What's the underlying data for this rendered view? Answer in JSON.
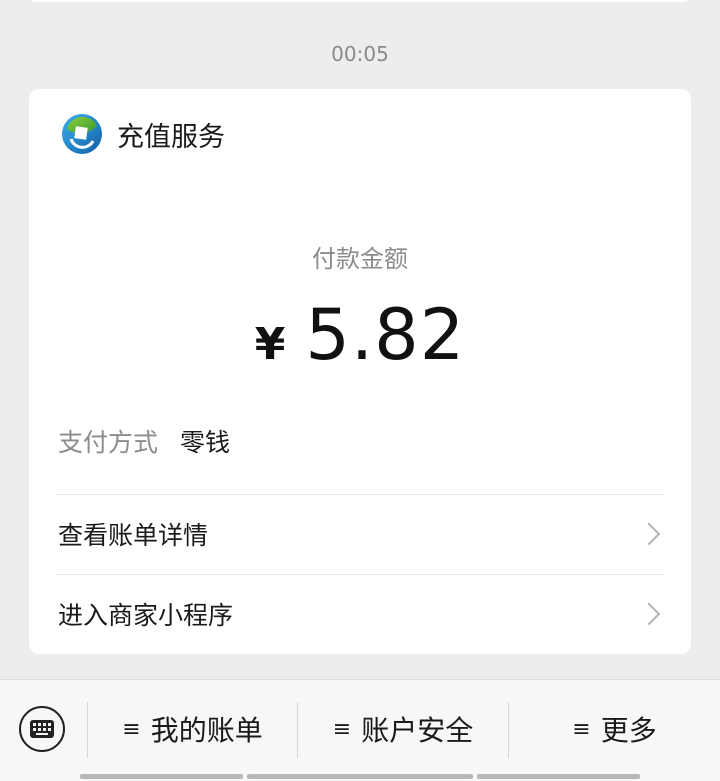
{
  "message": {
    "timestamp": "00:05",
    "card": {
      "service_name": "充值服务",
      "logo_icon": "e-logo-icon",
      "amount_label": "付款金额",
      "currency_symbol": "¥",
      "amount_value": "5.82",
      "payment_method_label": "支付方式",
      "payment_method_value": "零钱",
      "rows": [
        {
          "label": "查看账单详情"
        },
        {
          "label": "进入商家小程序"
        }
      ]
    }
  },
  "bottom_bar": {
    "keyboard_icon": "keyboard-icon",
    "menus": [
      {
        "label": "我的账单"
      },
      {
        "label": "账户安全"
      },
      {
        "label": "更多"
      }
    ],
    "menu_icon": "≡"
  }
}
